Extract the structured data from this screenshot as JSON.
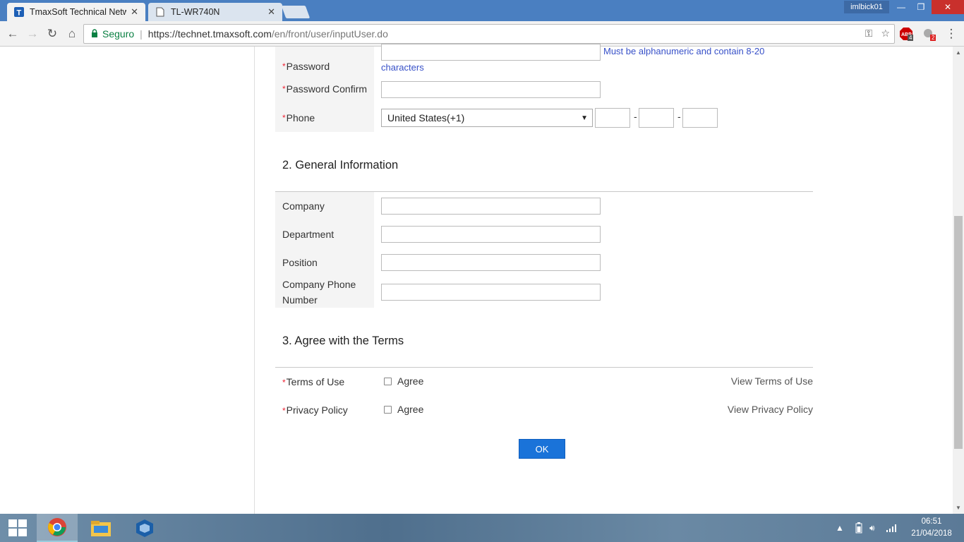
{
  "browser": {
    "tabs": [
      {
        "title": "TmaxSoft Technical Netw",
        "favicon": "tmaxsoft-icon",
        "active": true
      },
      {
        "title": "TL-WR740N",
        "favicon": "document-icon",
        "active": false
      }
    ],
    "user": "imlbick01",
    "secure_label": "Seguro",
    "url_host": "https://technet.tmaxsoft.com",
    "url_path": "/en/front/user/inputUser.do",
    "abp_count": "4",
    "ext_count": "2"
  },
  "form": {
    "password_label": "Password",
    "password_hint_line1": "Must be alphanumeric and contain 8-20",
    "password_hint_line2": "characters",
    "password_confirm_label": "Password Confirm",
    "phone_label": "Phone",
    "phone_country": "United States(+1)",
    "dash": "-",
    "section2_title": "2. General Information",
    "company_label": "Company",
    "department_label": "Department",
    "position_label": "Position",
    "company_phone_label_1": "Company Phone",
    "company_phone_label_2": "Number",
    "section3_title": "3. Agree with the Terms",
    "terms_label": "Terms of Use",
    "privacy_label": "Privacy Policy",
    "agree_label": "Agree",
    "view_terms": "View Terms of Use",
    "view_privacy": "View Privacy Policy",
    "ok_label": "OK",
    "required_mark": "*"
  },
  "taskbar": {
    "time": "06:51",
    "date": "21/04/2018"
  }
}
